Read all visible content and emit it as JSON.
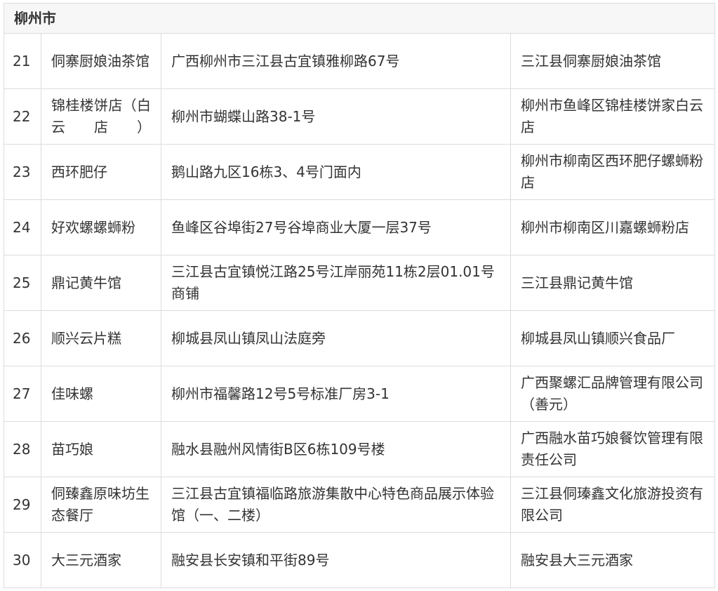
{
  "region": "柳州市",
  "rows": [
    {
      "num": "21",
      "name": "侗寨厨娘油茶馆",
      "address": "广西柳州市三江县古宜镇雅柳路67号",
      "operator": "三江县侗寨厨娘油茶馆"
    },
    {
      "num": "22",
      "name": "锦桂楼饼店（白云店）",
      "address": "柳州市蝴蝶山路38-1号",
      "operator": "柳州市鱼峰区锦桂楼饼家白云店"
    },
    {
      "num": "23",
      "name": "西环肥仔",
      "address": "鹅山路九区16栋3、4号门面内",
      "operator": "柳州市柳南区西环肥仔螺蛳粉店"
    },
    {
      "num": "24",
      "name": "好欢螺螺蛳粉",
      "address": "鱼峰区谷埠街27号谷埠商业大厦一层37号",
      "operator": "柳州市柳南区川嘉螺蛳粉店"
    },
    {
      "num": "25",
      "name": "鼎记黄牛馆",
      "address": "三江县古宜镇悦江路25号江岸丽苑11栋2层01.01号商铺",
      "operator": "三江县鼎记黄牛馆"
    },
    {
      "num": "26",
      "name": "顺兴云片糕",
      "address": "柳城县凤山镇凤山法庭旁",
      "operator": "柳城县凤山镇顺兴食品厂"
    },
    {
      "num": "27",
      "name": "佳味螺",
      "address": "柳州市福馨路12号5号标准厂房3-1",
      "operator": "广西聚螺汇品牌管理有限公司（善元）"
    },
    {
      "num": "28",
      "name": "苗巧娘",
      "address": "融水县融州风情街B区6栋109号楼",
      "operator": "广西融水苗巧娘餐饮管理有限责任公司"
    },
    {
      "num": "29",
      "name": "侗臻鑫原味坊生态餐厅",
      "address": "三江县古宜镇福临路旅游集散中心特色商品展示体验馆（一、二楼）",
      "operator": "三江县侗瑧鑫文化旅游投资有限公司"
    },
    {
      "num": "30",
      "name": "大三元酒家",
      "address": "融安县长安镇和平街89号",
      "operator": "融安县大三元酒家"
    }
  ]
}
